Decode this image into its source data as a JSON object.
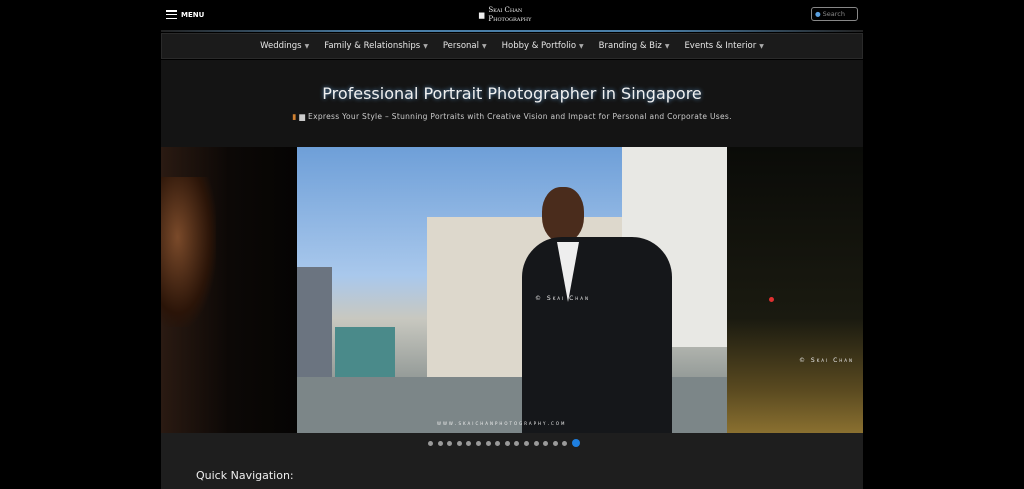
{
  "header": {
    "menu_label": "MENU",
    "logo_line1": "Skai Chan",
    "logo_line2": "Photography",
    "search_placeholder": "Search"
  },
  "nav": {
    "items": [
      {
        "label": "Weddings"
      },
      {
        "label": "Family & Relationships"
      },
      {
        "label": "Personal"
      },
      {
        "label": "Hobby & Portfolio"
      },
      {
        "label": "Branding & Biz"
      },
      {
        "label": "Events & Interior"
      }
    ]
  },
  "hero": {
    "title": "Professional Portrait Photographer in Singapore",
    "subtitle": "Express Your Style – Stunning Portraits with Creative Vision and Impact for Personal and Corporate Uses."
  },
  "carousel": {
    "watermark_name": "© Skai Chan",
    "watermark_url": "www.skaichanphotography.com",
    "slide_count": 16,
    "active_slide": 16,
    "accent": "#1e7fe0"
  },
  "quick_nav": {
    "title": "Quick Navigation:"
  }
}
